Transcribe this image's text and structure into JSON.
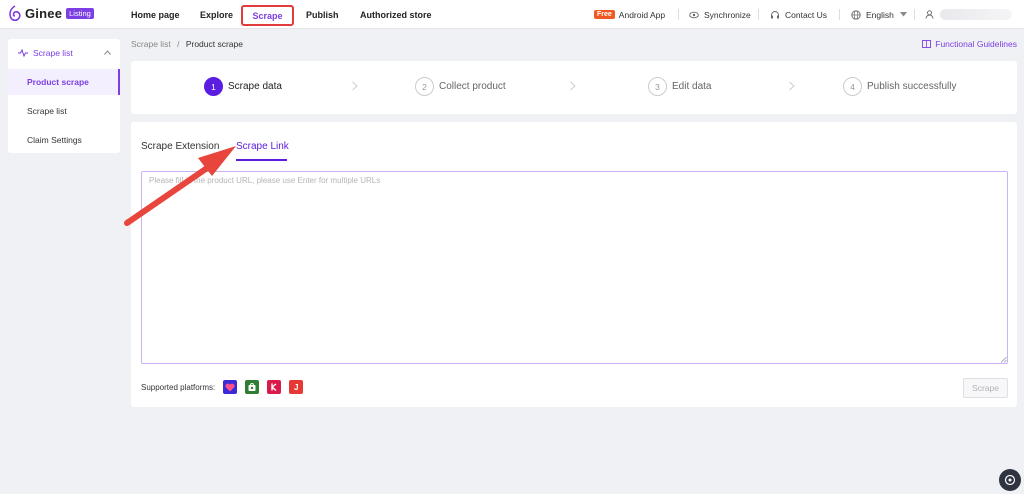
{
  "brand": {
    "name": "Ginee",
    "badge": "Listing",
    "accent": "#7b3fe4"
  },
  "nav": {
    "items": [
      {
        "label": "Home page"
      },
      {
        "label": "Explore"
      },
      {
        "label": "Scrape",
        "active": true
      },
      {
        "label": "Publish"
      },
      {
        "label": "Authorized store"
      }
    ],
    "right": {
      "free_badge": "Free",
      "android_app": "Android App",
      "synchronize": "Synchronize",
      "contact_us": "Contact Us",
      "language": "English"
    }
  },
  "sidebar": {
    "group_label": "Scrape list",
    "items": [
      {
        "label": "Product scrape",
        "active": true
      },
      {
        "label": "Scrape list"
      },
      {
        "label": "Claim Settings"
      }
    ]
  },
  "breadcrumb": {
    "parent": "Scrape list",
    "separator": "/",
    "current": "Product scrape"
  },
  "guidelines_label": "Functional Guidelines",
  "steps": [
    {
      "num": "1",
      "label": "Scrape data",
      "active": true
    },
    {
      "num": "2",
      "label": "Collect product"
    },
    {
      "num": "3",
      "label": "Edit data"
    },
    {
      "num": "4",
      "label": "Publish successfully"
    }
  ],
  "tabs": [
    {
      "label": "Scrape Extension"
    },
    {
      "label": "Scrape Link",
      "active": true
    }
  ],
  "url_input": {
    "placeholder": "Please fill in the product URL, please use Enter for multiple URLs",
    "value": ""
  },
  "platforms": {
    "label": "Supported platforms:",
    "icons": [
      {
        "name": "lazada-icon",
        "color": "#3a2bd6"
      },
      {
        "name": "shopee-icon",
        "color": "#2e7d32"
      },
      {
        "name": "bukalapak-icon",
        "color": "#d81b4a"
      },
      {
        "name": "jdid-icon",
        "color": "#e53935",
        "glyph": "J"
      }
    ]
  },
  "scrape_button_label": "Scrape",
  "annotation_color": "#e8453c"
}
